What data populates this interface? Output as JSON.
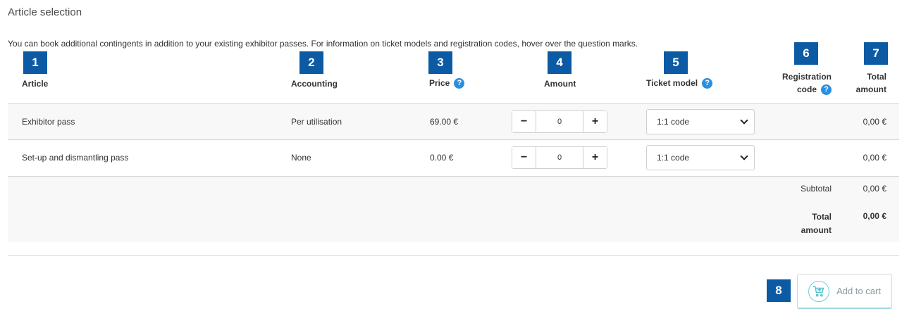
{
  "section_title": "Article selection",
  "intro": "You can book additional contingents in addition to your existing exhibitor passes. For information on ticket models and registration codes, hover over the question marks.",
  "badges": [
    "1",
    "2",
    "3",
    "4",
    "5",
    "6",
    "7",
    "8"
  ],
  "help_icon": "?",
  "columns": {
    "article": "Article",
    "accounting": "Accounting",
    "price": "Price",
    "amount": "Amount",
    "ticket_model": "Ticket model",
    "registration_code_line1": "Registration",
    "registration_code_line2": "code",
    "total_line1": "Total",
    "total_line2": "amount"
  },
  "rows": [
    {
      "article": "Exhibitor pass",
      "accounting": "Per utilisation",
      "price": "69.00 €",
      "amount": "0",
      "ticket_model": "1:1 code",
      "total": "0,00 €"
    },
    {
      "article": "Set-up and dismantling pass",
      "accounting": "None",
      "price": "0.00 €",
      "amount": "0",
      "ticket_model": "1:1 code",
      "total": "0,00 €"
    }
  ],
  "stepper": {
    "minus": "−",
    "plus": "+"
  },
  "summary": {
    "subtotal_label": "Subtotal",
    "subtotal_value": "0,00 €",
    "total_label_line1": "Total",
    "total_label_line2": "amount",
    "total_value": "0,00 €"
  },
  "cart": {
    "label": "Add to cart",
    "icon": "cart-icon"
  },
  "colors": {
    "badge": "#0b5aa3",
    "help_icon": "#2b8fe0",
    "cart_accent": "#6ecfd8",
    "summary_bg": "#f8f8f8"
  }
}
